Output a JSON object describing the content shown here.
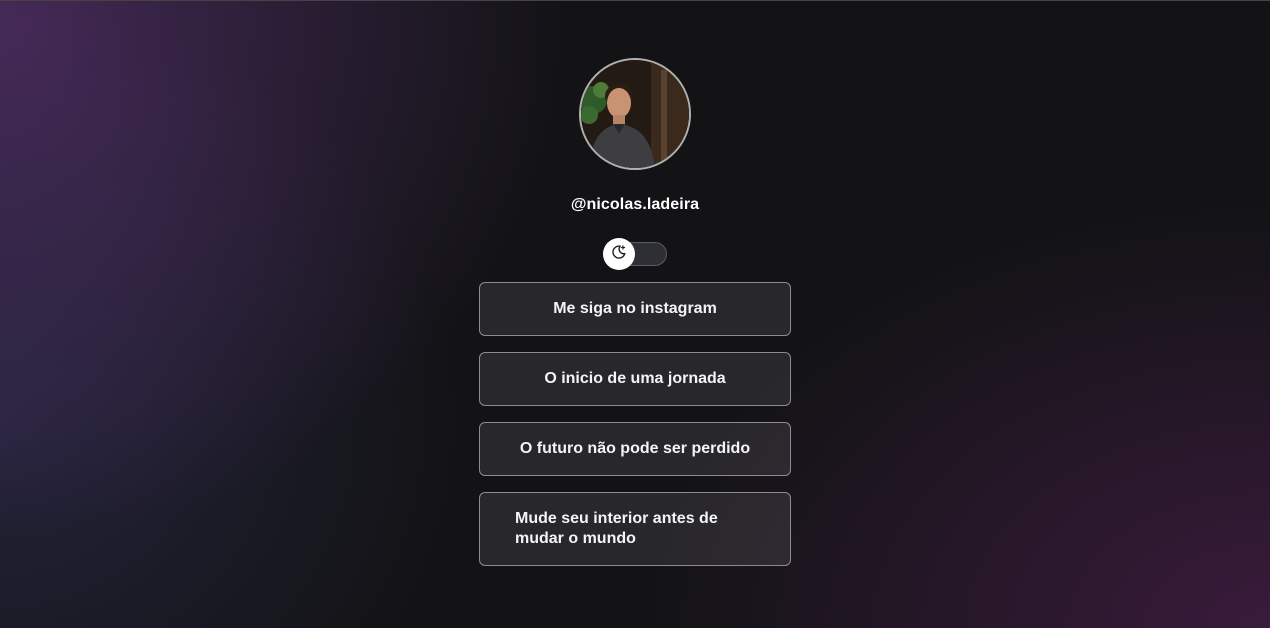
{
  "profile": {
    "avatar_alt": "Profile photo",
    "username": "@nicolas.ladeira"
  },
  "theme_toggle": {
    "icon": "moon-sparkle-icon",
    "state": "dark"
  },
  "links": [
    {
      "label": "Me siga no instagram"
    },
    {
      "label": "O inicio de uma jornada"
    },
    {
      "label": "O futuro não pode ser perdido"
    },
    {
      "label": "Mude seu interior antes de mudar o mundo"
    }
  ],
  "colors": {
    "background": "#131316",
    "accent_purple": "#6e3c8c",
    "button_border": "#8e8a95",
    "text": "#ffffff"
  }
}
